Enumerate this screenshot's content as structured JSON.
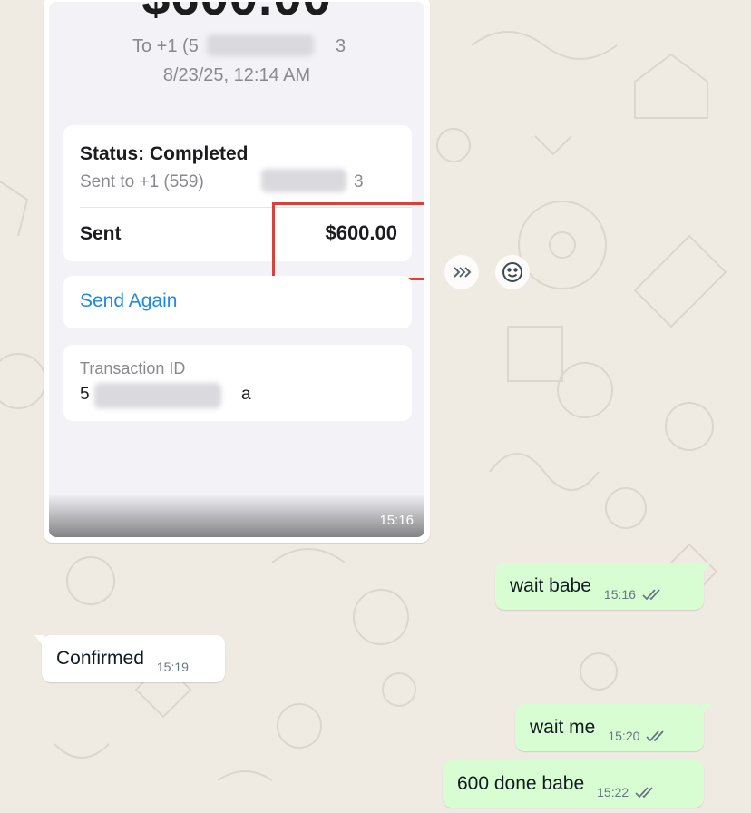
{
  "image_message": {
    "time": "15:16",
    "screenshot": {
      "amount_partial": "$600.00",
      "to_prefix": "To +1 (5",
      "to_suffix": "3",
      "date": "8/23/25, 12:14 AM",
      "status_title": "Status: Completed",
      "sent_to_prefix": "Sent to +1 (559)",
      "sent_to_suffix": "3",
      "sent_label": "Sent",
      "sent_amount": "$600.00",
      "send_again": "Send Again",
      "transaction_id_label": "Transaction ID",
      "transaction_id_visible": "5",
      "transaction_id_tail": "a"
    }
  },
  "actions": {
    "forward_icon": "forward-icon",
    "emoji_icon": "emoji-icon"
  },
  "messages": [
    {
      "direction": "out",
      "text": "wait babe",
      "time": "15:16",
      "status": "read"
    },
    {
      "direction": "in",
      "text": "Confirmed",
      "time": "15:19"
    },
    {
      "direction": "out",
      "text": "wait me",
      "time": "15:20",
      "status": "read"
    },
    {
      "direction": "out",
      "text": "600 done babe",
      "time": "15:22",
      "status": "read"
    }
  ],
  "colors": {
    "background": "#efeae2",
    "outgoing_bubble": "#d9fdd3",
    "incoming_bubble": "#ffffff",
    "highlight": "#d9413a",
    "link": "#1e8ae6"
  }
}
